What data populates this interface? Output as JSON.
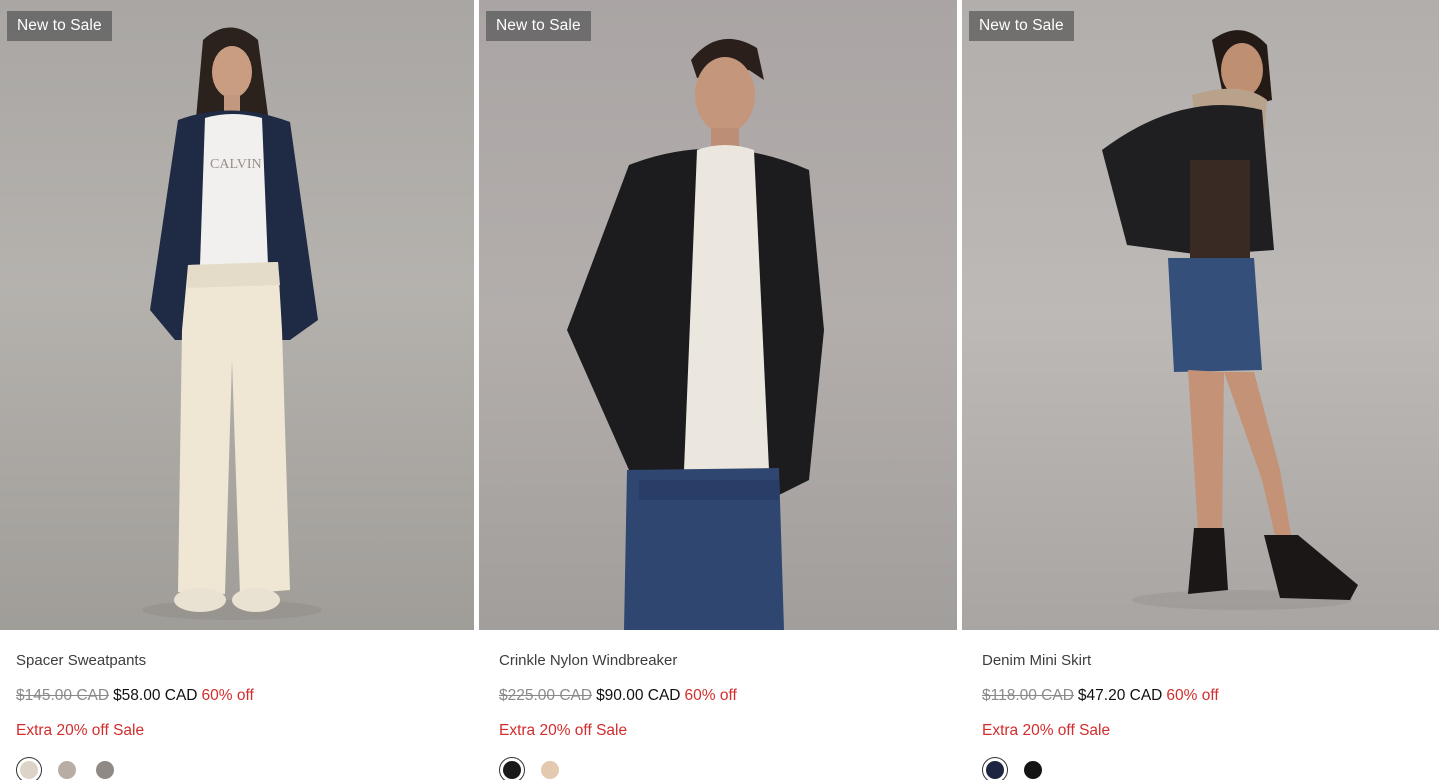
{
  "products": [
    {
      "badge": "New to Sale",
      "name": "Spacer Sweatpants",
      "was_price": "$145.00 CAD",
      "now_price": "$58.00 CAD",
      "discount": "60% off",
      "promo": "Extra 20% off Sale",
      "swatches": [
        "#ddd4c8",
        "#b8aca4",
        "#8f8a86"
      ],
      "selected_swatch": 0
    },
    {
      "badge": "New to Sale",
      "name": "Crinkle Nylon Windbreaker",
      "was_price": "$225.00 CAD",
      "now_price": "$90.00 CAD",
      "discount": "60% off",
      "promo": "Extra 20% off Sale",
      "swatches": [
        "#1a1a1a",
        "#e2c9b0"
      ],
      "selected_swatch": 0
    },
    {
      "badge": "New to Sale",
      "name": "Denim Mini Skirt",
      "was_price": "$118.00 CAD",
      "now_price": "$47.20 CAD",
      "discount": "60% off",
      "promo": "Extra 20% off Sale",
      "swatches": [
        "#1d2540",
        "#141414"
      ],
      "selected_swatch": 0
    }
  ],
  "colors": {
    "sale_red": "#d22d2d",
    "badge_bg": "#5c5c5c"
  }
}
